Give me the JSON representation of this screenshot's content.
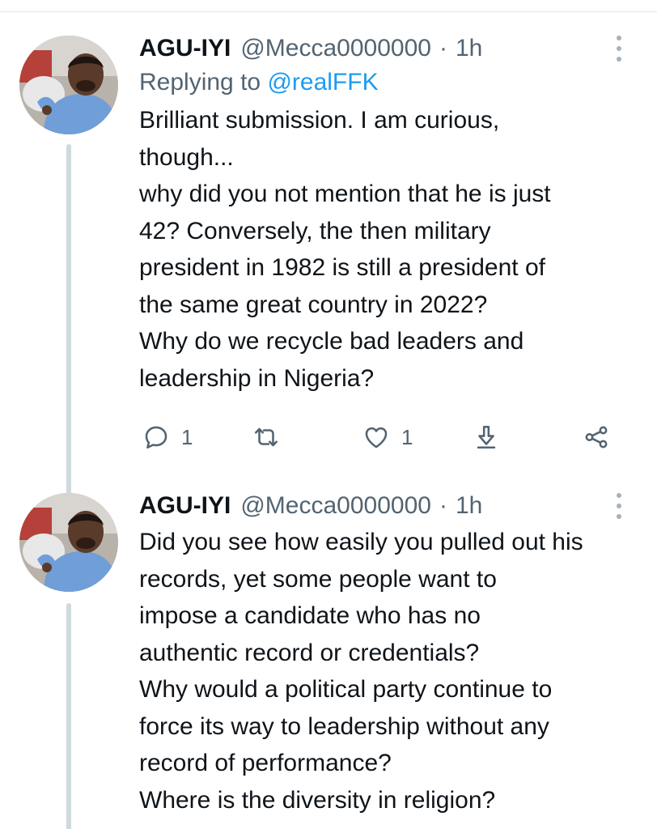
{
  "tweets": [
    {
      "author_name": "AGU-IYI",
      "handle": "@Mecca0000000",
      "separator": "·",
      "time": "1h",
      "replying_label": "Replying to",
      "replying_to": "@realFFK",
      "text_lines": [
        "Brilliant submission. I am curious,",
        "though...",
        "why did you not mention that he is just",
        "42? Conversely, the then military",
        "president in 1982 is still a president of",
        "the same great country in 2022?",
        "Why do we recycle bad leaders and",
        "leadership in Nigeria?"
      ],
      "reply_count": "1",
      "retweet_count": "",
      "like_count": "1"
    },
    {
      "author_name": "AGU-IYI",
      "handle": "@Mecca0000000",
      "separator": "·",
      "time": "1h",
      "text_lines": [
        "Did you see how easily you pulled out his",
        "records, yet some people want to",
        "impose a candidate who has no",
        "authentic record or credentials?",
        "Why would a political party continue to",
        "force its way to leadership without any",
        "record of performance?",
        "Where is the diversity in religion?"
      ]
    }
  ],
  "colors": {
    "text": "#0f1419",
    "muted": "#536471",
    "link": "#1d9bf0",
    "thread_line": "#cfd9de"
  },
  "icons": [
    "reply-icon",
    "retweet-icon",
    "like-icon",
    "download-share-icon",
    "share-nodes-icon",
    "more-options-icon"
  ]
}
